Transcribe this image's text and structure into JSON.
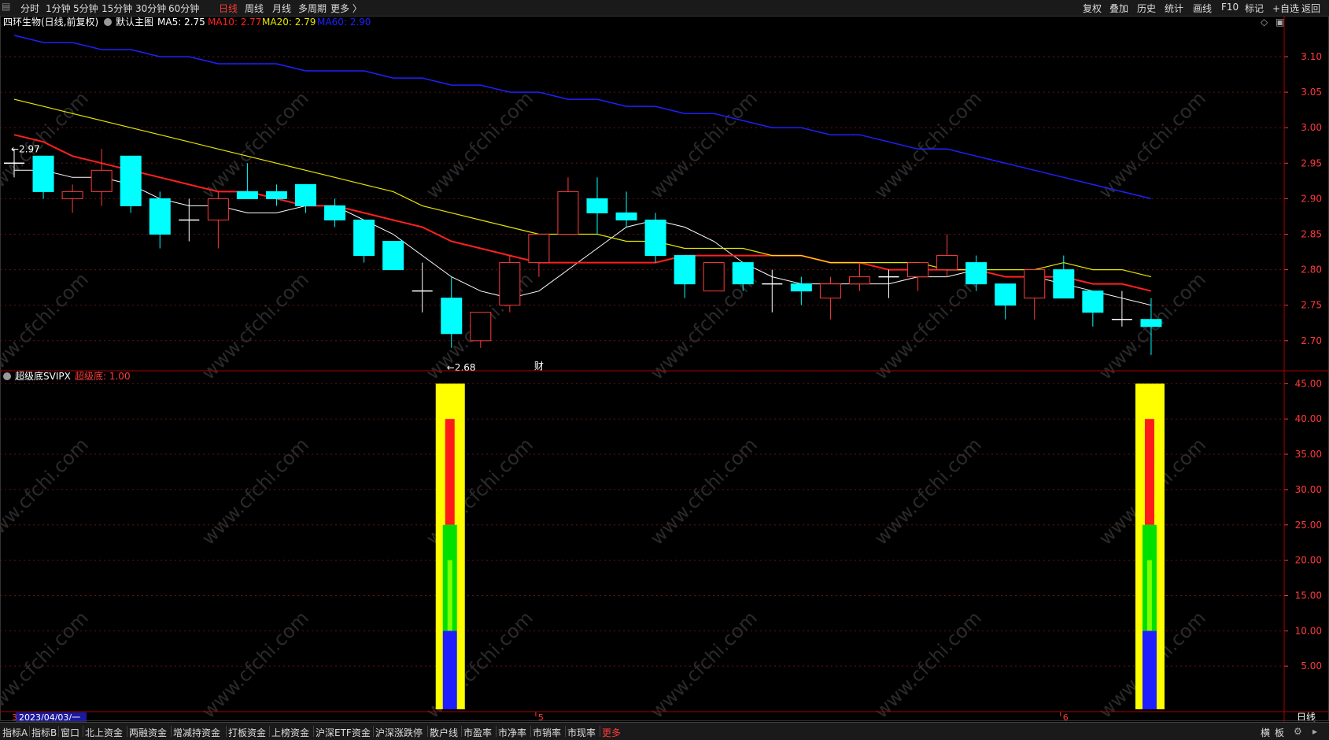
{
  "toolbar": {
    "period_tabs": [
      "分时",
      "1分钟",
      "5分钟",
      "15分钟",
      "30分钟",
      "60分钟",
      "日线",
      "周线",
      "月线",
      "多周期",
      "更多 〉"
    ],
    "active_tab": "日线",
    "right_buttons": [
      "复权",
      "叠加",
      "历史",
      "统计",
      "画线",
      "F10",
      "标记",
      "+自选",
      "返回"
    ]
  },
  "main_chart": {
    "stock_title": "四环生物(日线,前复权)",
    "template_label": "默认主图",
    "ma_legend": [
      {
        "label": "MA5: 2.75",
        "color": "#ffffff"
      },
      {
        "label": "MA10: 2.77",
        "color": "#ff2020"
      },
      {
        "label": "MA20: 2.79",
        "color": "#e6e600"
      },
      {
        "label": "MA60: 2.90",
        "color": "#2020ff"
      }
    ],
    "high_marker": "2.97",
    "low_marker": "2.68",
    "event_marker": "财",
    "watermark": "www.cfchi.com"
  },
  "indicator_panel": {
    "title": "超级底SVIPX",
    "value_label": "超级底: 1.00"
  },
  "footer": {
    "date_label": "2023/04/03/一",
    "month_labels": [
      "5",
      "6"
    ],
    "period_badge": "日线",
    "bottom_tabs": [
      "指标A",
      "指标B",
      "窗口",
      "北上资金",
      "两融资金",
      "增减持资金",
      "打板资金",
      "上榜资金",
      "沪深ETF资金",
      "沪深涨跌停",
      "散户线",
      "市盈率",
      "市净率",
      "市销率",
      "市现率",
      "更多"
    ],
    "right_items": [
      "横",
      "板"
    ]
  },
  "colors": {
    "up": "#ff3b3b",
    "down": "#00ffff",
    "ma5": "#ffffff",
    "ma10": "#ff2020",
    "ma20": "#e6e600",
    "ma60": "#2020ff",
    "axis": "#ff3b3b",
    "grid": "#6a1010"
  },
  "chart_data": [
    {
      "type": "candlestick",
      "title": "四环生物(日线,前复权)",
      "ylim": [
        2.64,
        3.14
      ],
      "y_ticks": [
        "3.10",
        "3.05",
        "3.00",
        "2.95",
        "2.90",
        "2.85",
        "2.80",
        "2.75",
        "2.70"
      ],
      "candles": [
        {
          "o": 2.95,
          "h": 2.97,
          "l": 2.93,
          "c": 2.95
        },
        {
          "o": 2.96,
          "h": 2.96,
          "l": 2.9,
          "c": 2.91
        },
        {
          "o": 2.9,
          "h": 2.92,
          "l": 2.88,
          "c": 2.91
        },
        {
          "o": 2.91,
          "h": 2.97,
          "l": 2.89,
          "c": 2.94
        },
        {
          "o": 2.96,
          "h": 2.96,
          "l": 2.88,
          "c": 2.89
        },
        {
          "o": 2.9,
          "h": 2.91,
          "l": 2.83,
          "c": 2.85
        },
        {
          "o": 2.87,
          "h": 2.9,
          "l": 2.84,
          "c": 2.87
        },
        {
          "o": 2.87,
          "h": 2.91,
          "l": 2.83,
          "c": 2.9
        },
        {
          "o": 2.91,
          "h": 2.95,
          "l": 2.9,
          "c": 2.9
        },
        {
          "o": 2.91,
          "h": 2.92,
          "l": 2.89,
          "c": 2.9
        },
        {
          "o": 2.92,
          "h": 2.92,
          "l": 2.88,
          "c": 2.89
        },
        {
          "o": 2.89,
          "h": 2.9,
          "l": 2.86,
          "c": 2.87
        },
        {
          "o": 2.87,
          "h": 2.87,
          "l": 2.81,
          "c": 2.82
        },
        {
          "o": 2.84,
          "h": 2.84,
          "l": 2.8,
          "c": 2.8
        },
        {
          "o": 2.77,
          "h": 2.81,
          "l": 2.74,
          "c": 2.77
        },
        {
          "o": 2.76,
          "h": 2.79,
          "l": 2.69,
          "c": 2.71
        },
        {
          "o": 2.7,
          "h": 2.74,
          "l": 2.69,
          "c": 2.74
        },
        {
          "o": 2.75,
          "h": 2.82,
          "l": 2.74,
          "c": 2.81
        },
        {
          "o": 2.81,
          "h": 2.85,
          "l": 2.79,
          "c": 2.85
        },
        {
          "o": 2.85,
          "h": 2.93,
          "l": 2.85,
          "c": 2.91
        },
        {
          "o": 2.9,
          "h": 2.93,
          "l": 2.85,
          "c": 2.88
        },
        {
          "o": 2.88,
          "h": 2.91,
          "l": 2.86,
          "c": 2.87
        },
        {
          "o": 2.87,
          "h": 2.88,
          "l": 2.81,
          "c": 2.82
        },
        {
          "o": 2.82,
          "h": 2.82,
          "l": 2.76,
          "c": 2.78
        },
        {
          "o": 2.77,
          "h": 2.81,
          "l": 2.77,
          "c": 2.81
        },
        {
          "o": 2.81,
          "h": 2.81,
          "l": 2.77,
          "c": 2.78
        },
        {
          "o": 2.78,
          "h": 2.8,
          "l": 2.74,
          "c": 2.78
        },
        {
          "o": 2.78,
          "h": 2.79,
          "l": 2.75,
          "c": 2.77
        },
        {
          "o": 2.76,
          "h": 2.79,
          "l": 2.73,
          "c": 2.78
        },
        {
          "o": 2.78,
          "h": 2.81,
          "l": 2.77,
          "c": 2.79
        },
        {
          "o": 2.79,
          "h": 2.8,
          "l": 2.76,
          "c": 2.79
        },
        {
          "o": 2.79,
          "h": 2.81,
          "l": 2.77,
          "c": 2.81
        },
        {
          "o": 2.8,
          "h": 2.85,
          "l": 2.79,
          "c": 2.82
        },
        {
          "o": 2.81,
          "h": 2.82,
          "l": 2.77,
          "c": 2.78
        },
        {
          "o": 2.78,
          "h": 2.78,
          "l": 2.73,
          "c": 2.75
        },
        {
          "o": 2.76,
          "h": 2.8,
          "l": 2.73,
          "c": 2.8
        },
        {
          "o": 2.8,
          "h": 2.82,
          "l": 2.76,
          "c": 2.76
        },
        {
          "o": 2.77,
          "h": 2.77,
          "l": 2.72,
          "c": 2.74
        },
        {
          "o": 2.73,
          "h": 2.77,
          "l": 2.72,
          "c": 2.73
        },
        {
          "o": 2.73,
          "h": 2.76,
          "l": 2.68,
          "c": 2.72
        }
      ],
      "series": [
        {
          "name": "MA5",
          "values": [
            2.94,
            2.94,
            2.93,
            2.93,
            2.92,
            2.9,
            2.89,
            2.89,
            2.88,
            2.88,
            2.89,
            2.89,
            2.87,
            2.85,
            2.82,
            2.79,
            2.77,
            2.76,
            2.77,
            2.8,
            2.83,
            2.86,
            2.87,
            2.86,
            2.84,
            2.81,
            2.79,
            2.78,
            2.78,
            2.78,
            2.78,
            2.79,
            2.79,
            2.8,
            2.79,
            2.79,
            2.78,
            2.77,
            2.76,
            2.75
          ]
        },
        {
          "name": "MA10",
          "values": [
            2.99,
            2.98,
            2.96,
            2.95,
            2.94,
            2.93,
            2.92,
            2.91,
            2.91,
            2.9,
            2.89,
            2.89,
            2.88,
            2.87,
            2.86,
            2.84,
            2.83,
            2.82,
            2.81,
            2.81,
            2.81,
            2.81,
            2.81,
            2.82,
            2.82,
            2.82,
            2.82,
            2.82,
            2.81,
            2.81,
            2.8,
            2.8,
            2.8,
            2.8,
            2.79,
            2.79,
            2.79,
            2.78,
            2.78,
            2.77
          ]
        },
        {
          "name": "MA20",
          "values": [
            3.04,
            3.03,
            3.02,
            3.01,
            3.0,
            2.99,
            2.98,
            2.97,
            2.96,
            2.95,
            2.94,
            2.93,
            2.92,
            2.91,
            2.89,
            2.88,
            2.87,
            2.86,
            2.85,
            2.85,
            2.85,
            2.84,
            2.84,
            2.83,
            2.83,
            2.83,
            2.82,
            2.82,
            2.81,
            2.81,
            2.81,
            2.81,
            2.8,
            2.8,
            2.8,
            2.8,
            2.81,
            2.8,
            2.8,
            2.79
          ]
        },
        {
          "name": "MA60",
          "values": [
            3.13,
            3.12,
            3.12,
            3.11,
            3.11,
            3.1,
            3.1,
            3.09,
            3.09,
            3.09,
            3.08,
            3.08,
            3.08,
            3.07,
            3.07,
            3.06,
            3.06,
            3.05,
            3.05,
            3.04,
            3.04,
            3.03,
            3.03,
            3.02,
            3.02,
            3.01,
            3.0,
            3.0,
            2.99,
            2.99,
            2.98,
            2.97,
            2.97,
            2.96,
            2.95,
            2.94,
            2.93,
            2.92,
            2.91,
            2.9
          ]
        }
      ]
    },
    {
      "type": "bar",
      "title": "超级底SVIPX",
      "ylim": [
        0,
        48
      ],
      "y_ticks": [
        "45.00",
        "40.00",
        "35.00",
        "30.00",
        "25.00",
        "20.00",
        "15.00",
        "10.00",
        "5.00"
      ],
      "signals": [
        {
          "index": 15,
          "yellow": 45,
          "red": [
            25,
            40
          ],
          "green": [
            10,
            25
          ],
          "green_core": [
            6,
            20
          ],
          "blue": [
            0,
            10
          ]
        },
        {
          "index": 39,
          "yellow": 45,
          "red": [
            25,
            40
          ],
          "green": [
            10,
            25
          ],
          "green_core": [
            6,
            20
          ],
          "blue": [
            0,
            10
          ]
        }
      ]
    }
  ]
}
